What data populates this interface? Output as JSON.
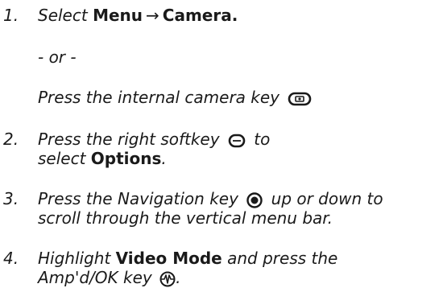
{
  "steps": [
    {
      "number": "1.",
      "prefix": "Select ",
      "menu": "Menu",
      "arrow": "→",
      "camera": "Camera.",
      "or": "- or -",
      "alt": "Press the internal camera key",
      "alt_icon": "camera-key-icon"
    },
    {
      "number": "2.",
      "line1": "Press the right softkey",
      "line1_icon": "right-softkey-icon",
      "line1_tail": "to",
      "line2_prefix": "select ",
      "line2_bold": "Options",
      "line2_suffix": "."
    },
    {
      "number": "3.",
      "line1": "Press the Navigation key",
      "line1_icon": "navigation-key-icon",
      "line1_tail": "up or down to",
      "line2": "scroll through the vertical menu bar."
    },
    {
      "number": "4.",
      "line1_prefix": "Highlight ",
      "line1_bold": "Video Mode",
      "line1_suffix": " and press the",
      "line2": "Amp'd/OK key",
      "line2_icon": "ampd-ok-key-icon",
      "line2_suffix": "."
    }
  ]
}
